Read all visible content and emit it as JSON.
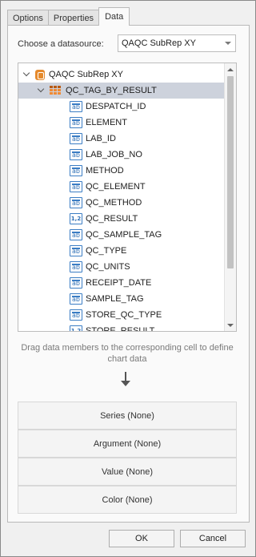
{
  "tabs": [
    {
      "label": "Options",
      "active": false
    },
    {
      "label": "Properties",
      "active": false
    },
    {
      "label": "Data",
      "active": true
    }
  ],
  "datasource": {
    "label": "Choose a datasource:",
    "value": "QAQC SubRep XY"
  },
  "tree": {
    "root": {
      "label": "QAQC SubRep XY",
      "icon": "database-icon",
      "expanded": true
    },
    "table": {
      "label": "QC_TAG_BY_RESULT",
      "icon": "table-icon",
      "expanded": true,
      "selected": true
    },
    "fields": [
      {
        "label": "DESPATCH_ID",
        "icon": "text-field-icon",
        "glyph": "ab"
      },
      {
        "label": "ELEMENT",
        "icon": "text-field-icon",
        "glyph": "ab"
      },
      {
        "label": "LAB_ID",
        "icon": "text-field-icon",
        "glyph": "ab"
      },
      {
        "label": "LAB_JOB_NO",
        "icon": "text-field-icon",
        "glyph": "ab"
      },
      {
        "label": "METHOD",
        "icon": "text-field-icon",
        "glyph": "ab"
      },
      {
        "label": "QC_ELEMENT",
        "icon": "text-field-icon",
        "glyph": "ab"
      },
      {
        "label": "QC_METHOD",
        "icon": "text-field-icon",
        "glyph": "ab"
      },
      {
        "label": "QC_RESULT",
        "icon": "numeric-field-icon",
        "glyph": "1,2"
      },
      {
        "label": "QC_SAMPLE_TAG",
        "icon": "text-field-icon",
        "glyph": "ab"
      },
      {
        "label": "QC_TYPE",
        "icon": "text-field-icon",
        "glyph": "ab"
      },
      {
        "label": "QC_UNITS",
        "icon": "text-field-icon",
        "glyph": "ab"
      },
      {
        "label": "RECEIPT_DATE",
        "icon": "text-field-icon",
        "glyph": "ab"
      },
      {
        "label": "SAMPLE_TAG",
        "icon": "text-field-icon",
        "glyph": "ab"
      },
      {
        "label": "STORE_QC_TYPE",
        "icon": "text-field-icon",
        "glyph": "ab"
      },
      {
        "label": "STORE_RESULT",
        "icon": "numeric-field-icon",
        "glyph": "1,2"
      }
    ]
  },
  "hint": "Drag data members to the corresponding cell to define chart data",
  "slots": [
    {
      "label": "Series (None)"
    },
    {
      "label": "Argument (None)"
    },
    {
      "label": "Value (None)"
    },
    {
      "label": "Color (None)"
    }
  ],
  "footer": {
    "ok_label": "OK",
    "cancel_label": "Cancel"
  }
}
